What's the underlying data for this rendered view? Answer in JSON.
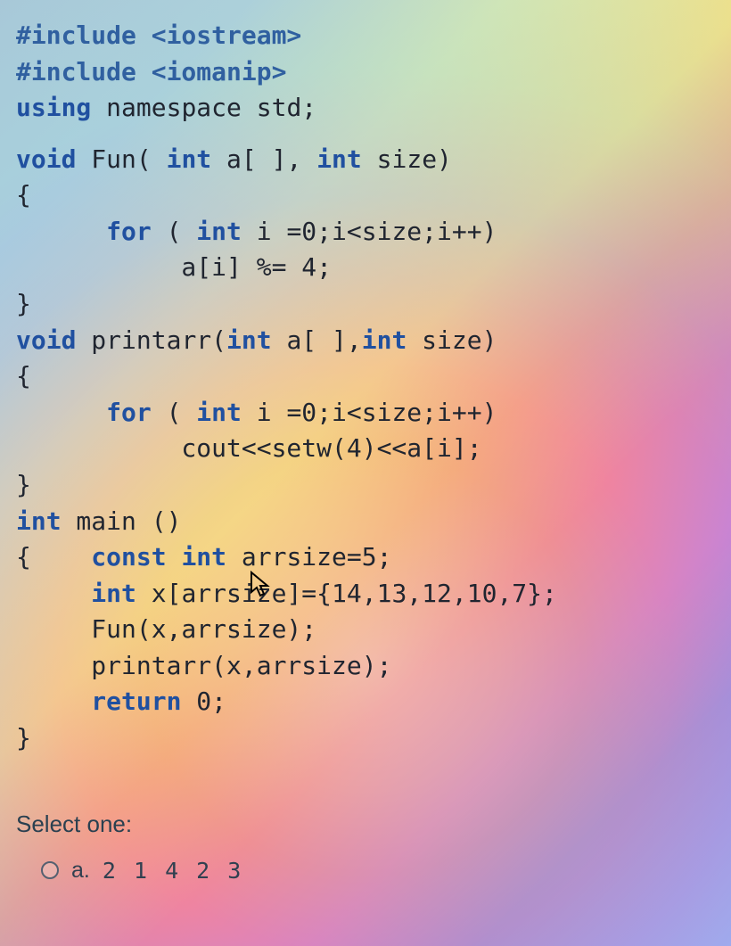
{
  "code": {
    "l1": "#include <iostream>",
    "l2": "#include <iomanip>",
    "l3a": "using",
    "l3b": " namespace std;",
    "l4a": "void",
    "l4b": " Fun( ",
    "l4c": "int",
    "l4d": " a[ ], ",
    "l4e": "int",
    "l4f": " size)",
    "l5": "{",
    "l6a": "      for",
    "l6b": " ( ",
    "l6c": "int",
    "l6d": " i =0;i<size;i++)",
    "l7": "           a[i] %= 4;",
    "l8": "}",
    "l9a": "void",
    "l9b": " printarr(",
    "l9c": "int",
    "l9d": " a[ ],",
    "l9e": "int",
    "l9f": " size)",
    "l10": "{",
    "l11a": "      for",
    "l11b": " ( ",
    "l11c": "int",
    "l11d": " i =0;i<size;i++)",
    "l12": "           cout<<setw(4)<<a[i];",
    "l13": "}",
    "l14a": "int",
    "l14b": " main ()",
    "l15a": "{    ",
    "l15b": "const int",
    "l15c": " arrsize=5;",
    "l16a": "     ",
    "l16b": "int",
    "l16c": " x[arrsize]={14,13,12,10,7};",
    "l17": "     Fun(x,arrsize);",
    "l18": "     printarr(x,arrsize);",
    "l19a": "     ",
    "l19b": "return",
    "l19c": " 0;",
    "l20": "}"
  },
  "question": {
    "prompt": "Select one:",
    "option_a_label": "a.",
    "option_a_value": "2   1   4   2   3"
  }
}
